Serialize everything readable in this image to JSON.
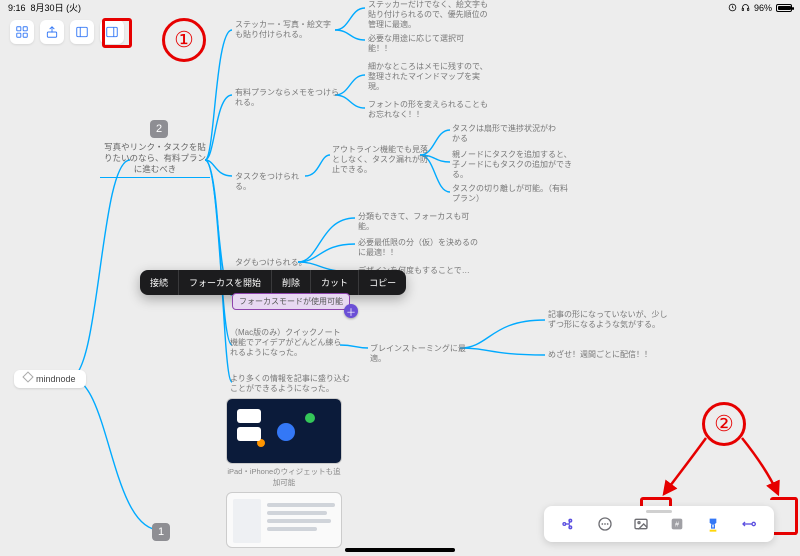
{
  "status": {
    "time": "9:16",
    "date": "8月30日 (火)",
    "battery_pct": "96%"
  },
  "root": {
    "label": "mindnode"
  },
  "branch2": {
    "title": "写真やリンク・タスクを貼りたいのなら、有料プランに進むべき"
  },
  "nodes": {
    "sticker": "ステッカー・写真・絵文字も貼り付けられる。",
    "sticker_sub1": "ステッカーだけでなく、絵文字も貼り付けられるので、優先順位の管理に最適。",
    "sticker_sub2": "必要な用途に応じて選択可能！！",
    "memo": "有料プランならメモをつけられる。",
    "memo_sub1": "細かなところはメモに残すので、整理されたマインドマップを実現。",
    "memo_sub2": "フォントの形を変えられることもお忘れなく！！",
    "task": "タスクをつけられる。",
    "task_sub1": "アウトライン機能でも見落としなく、タスク漏れが防止できる。",
    "task_sub1a": "タスクは扇形で進捗状況がわかる",
    "task_sub1b": "親ノードにタスクを追加すると、子ノードにもタスクの追加ができる。",
    "task_sub1c": "タスクの切り離しが可能。（有料プラン）",
    "cat": "分類もできて、フォーカスも可能。",
    "min": "必要最低限の分（仮）を決めるのに最適！！",
    "tag": "タグもつけられる。",
    "focus": "フォーカスモードが使用可能",
    "focus_sub": "デザインを何度もすることで…",
    "quick": "（Mac版のみ）クイックノート機能でアイデアがどんどん練られるようになった。",
    "brain": "ブレインストーミングに最適。",
    "brain_sub1": "記事の形になっていないが、少しずつ形になるような気がする。",
    "brain_sub2": "めざせ！週間ごとに配信！！",
    "more": "より多くの情報を記事に盛り込むことができるようになった。",
    "widget": "iPad・iPhoneのウィジェットも追加可能"
  },
  "context_menu": {
    "connect": "接続",
    "focus_start": "フォーカスを開始",
    "delete": "削除",
    "cut": "カット",
    "copy": "コピー"
  },
  "annotations": {
    "one": "①",
    "two": "②"
  }
}
